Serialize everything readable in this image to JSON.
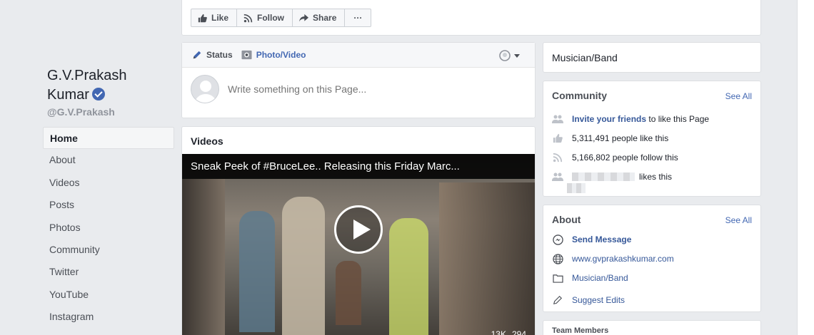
{
  "page": {
    "name_line1": "G.V.Prakash",
    "name_line2": "Kumar",
    "handle": "@G.V.Prakash"
  },
  "left_nav": {
    "items": [
      {
        "label": "Home",
        "active": true
      },
      {
        "label": "About"
      },
      {
        "label": "Videos"
      },
      {
        "label": "Posts"
      },
      {
        "label": "Photos"
      },
      {
        "label": "Community"
      },
      {
        "label": "Twitter"
      },
      {
        "label": "YouTube"
      },
      {
        "label": "Instagram"
      }
    ]
  },
  "action_bar": {
    "like": "Like",
    "follow": "Follow",
    "share": "Share",
    "more": "···"
  },
  "composer": {
    "tab_status": "Status",
    "tab_photo": "Photo/Video",
    "placeholder": "Write something on this Page..."
  },
  "videos": {
    "title": "Videos",
    "video_title": "Sneak Peek of #BruceLee.. Releasing this Friday Marc...",
    "likes": "13K",
    "comments": "294"
  },
  "category": {
    "label": "Musician/Band"
  },
  "community": {
    "title": "Community",
    "see_all": "See All",
    "invite_link": "Invite your friends",
    "invite_rest": " to like this Page",
    "likes_text": "5,311,491 people like this",
    "follows_text": "5,166,802 people follow this",
    "friend_likes": "likes this"
  },
  "about": {
    "title": "About",
    "see_all": "See All",
    "send_message": "Send Message",
    "website": "www.gvprakashkumar.com",
    "category": "Musician/Band",
    "suggest": "Suggest Edits"
  },
  "team": {
    "title": "Team Members"
  },
  "colors": {
    "background": "#e9ebee",
    "link": "#365899",
    "accent": "#4267b2"
  }
}
